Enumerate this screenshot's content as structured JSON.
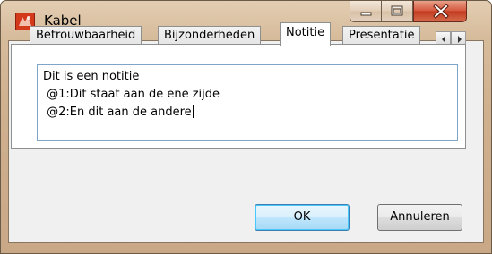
{
  "window": {
    "title": "Kabel"
  },
  "title_buttons": {
    "minimize": "minimize-icon",
    "maximize": "maximize-icon",
    "close": "close-icon"
  },
  "tabs": [
    {
      "label": "Betrouwbaarheid",
      "active": false
    },
    {
      "label": "Bijzonderheden",
      "active": false
    },
    {
      "label": "Notitie",
      "active": true
    },
    {
      "label": "Presentatie",
      "active": false
    }
  ],
  "note": {
    "lines": [
      "Dit is een notitie",
      " @1:Dit staat aan de ene zijde",
      " @2:En dit aan de andere"
    ]
  },
  "buttons": {
    "ok": "OK",
    "cancel": "Annuleren"
  },
  "colors": {
    "accent": "#3c7fb1",
    "close": "#c23a1f"
  }
}
